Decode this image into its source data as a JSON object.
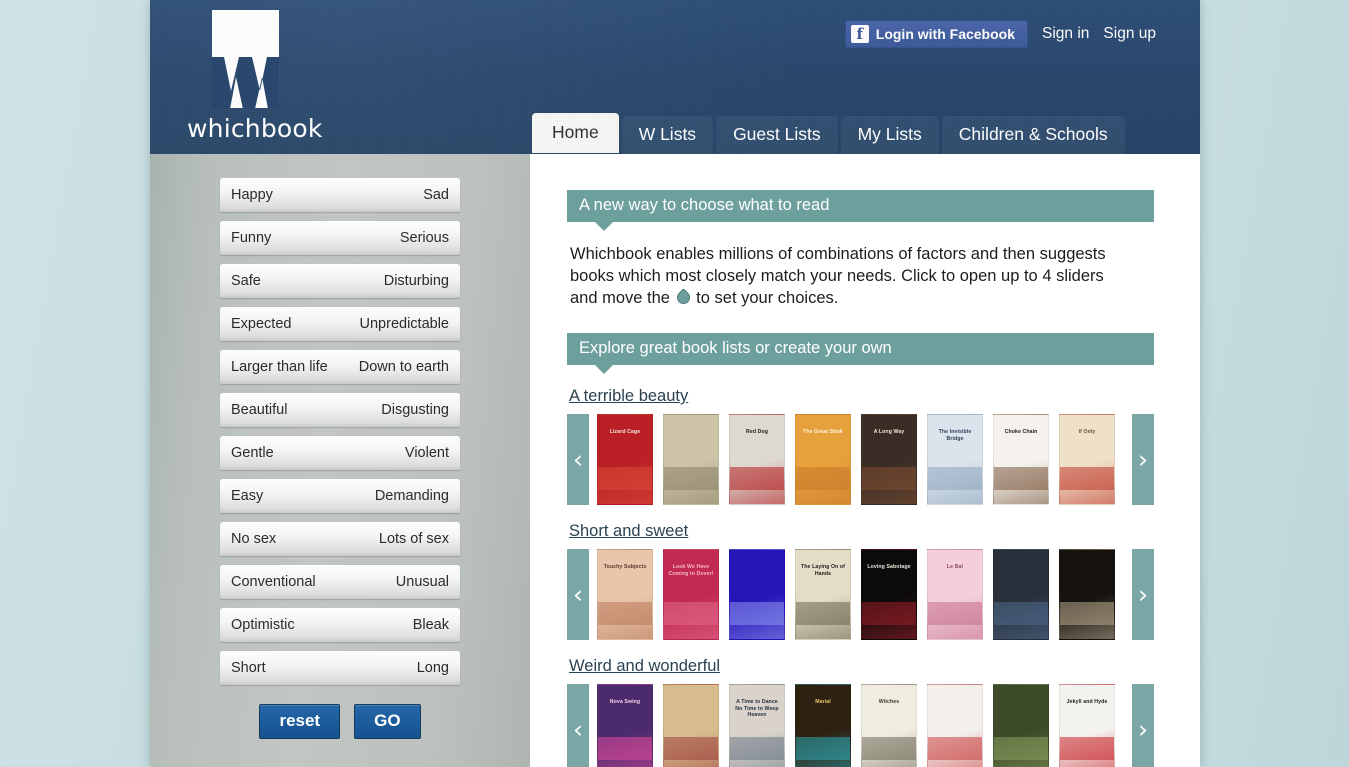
{
  "site": {
    "logo_word": "whichbook",
    "logo_icon": "whichbook-w-logo"
  },
  "header": {
    "facebook_button": "Login with Facebook",
    "facebook_glyph": "f",
    "sign_in": "Sign in",
    "sign_up": "Sign up",
    "nav": [
      {
        "label": "Home",
        "active": true
      },
      {
        "label": "W Lists",
        "active": false
      },
      {
        "label": "Guest Lists",
        "active": false
      },
      {
        "label": "My Lists",
        "active": false
      },
      {
        "label": "Children & Schools",
        "active": false
      }
    ]
  },
  "sidebar": {
    "sliders": [
      {
        "left": "Happy",
        "right": "Sad"
      },
      {
        "left": "Funny",
        "right": "Serious"
      },
      {
        "left": "Safe",
        "right": "Disturbing"
      },
      {
        "left": "Expected",
        "right": "Unpredictable"
      },
      {
        "left": "Larger than life",
        "right": "Down to earth"
      },
      {
        "left": "Beautiful",
        "right": "Disgusting"
      },
      {
        "left": "Gentle",
        "right": "Violent"
      },
      {
        "left": "Easy",
        "right": "Demanding"
      },
      {
        "left": "No sex",
        "right": "Lots of sex"
      },
      {
        "left": "Conventional",
        "right": "Unusual"
      },
      {
        "left": "Optimistic",
        "right": "Bleak"
      },
      {
        "left": "Short",
        "right": "Long"
      }
    ],
    "reset_label": "reset",
    "go_label": "GO"
  },
  "main": {
    "banner_1": "A new way to choose what to read",
    "intro_part_1": "Whichbook enables millions of combinations of factors and then suggests books which most closely match your needs. Click to open up to 4 sliders and move the",
    "intro_part_2": "to set your choices.",
    "banner_2": "Explore great book lists or create your own",
    "prev_arrow": "‹",
    "next_arrow": "›",
    "lists": [
      {
        "title": "A terrible beauty",
        "books": [
          {
            "title": "Lizard Cage",
            "bg": "#bb2027",
            "fg": "#f2e7da",
            "accent": "#d94a36"
          },
          {
            "title": "",
            "bg": "#cdc4a8",
            "fg": "#5c5645",
            "accent": "#8d8468"
          },
          {
            "title": "Red Dog",
            "bg": "#ddd8d0",
            "fg": "#1d1d1d",
            "accent": "#b31f22"
          },
          {
            "title": "The Great Stink",
            "bg": "#e6a13c",
            "fg": "#fdf4e2",
            "accent": "#c8792a"
          },
          {
            "title": "A Long Way",
            "bg": "#3a2d26",
            "fg": "#f0e6d8",
            "accent": "#7d4f32"
          },
          {
            "title": "The Invisible Bridge",
            "bg": "#dbe4ec",
            "fg": "#2c3f56",
            "accent": "#8ea5bd"
          },
          {
            "title": "Choke Chain",
            "bg": "#f5f2ee",
            "fg": "#1c1c1c",
            "accent": "#7b5a3e"
          },
          {
            "title": "If Only",
            "bg": "#efe0c8",
            "fg": "#6a5036",
            "accent": "#c0392b"
          }
        ]
      },
      {
        "title": "Short and sweet",
        "books": [
          {
            "title": "Touchy Subjects",
            "bg": "#e9c6ab",
            "fg": "#53382a",
            "accent": "#b9795a"
          },
          {
            "title": "Look We Have Coming to Dover!",
            "bg": "#c32a52",
            "fg": "#f2b6c6",
            "accent": "#e06a8c"
          },
          {
            "title": "",
            "bg": "#2616b8",
            "fg": "#cfd2f5",
            "accent": "#8d93ee"
          },
          {
            "title": "The Laying On of Hands",
            "bg": "#e3dcc6",
            "fg": "#1d1d1d",
            "accent": "#6c6550"
          },
          {
            "title": "Loving Sabotage",
            "bg": "#0b0b0b",
            "fg": "#e8e2da",
            "accent": "#9c1f28"
          },
          {
            "title": "Le Bal",
            "bg": "#f4cedc",
            "fg": "#8b4a63",
            "accent": "#c4708e"
          },
          {
            "title": "",
            "bg": "#2a2f3c",
            "fg": "#b9c3d4",
            "accent": "#4e6c8d"
          },
          {
            "title": "",
            "bg": "#15120f",
            "fg": "#cfc3b0",
            "accent": "#b9a88d"
          }
        ]
      },
      {
        "title": "Weird and wonderful",
        "books": [
          {
            "title": "Nova Swing",
            "bg": "#4b2b6e",
            "fg": "#f2d0e4",
            "accent": "#e04a9b"
          },
          {
            "title": "",
            "bg": "#d7bd8e",
            "fg": "#5c4424",
            "accent": "#9c3f3a"
          },
          {
            "title": "A Time to Dance No Time to Weep Heaven",
            "bg": "#d9d3cb",
            "fg": "#23303f",
            "accent": "#6b7886"
          },
          {
            "title": "Marial",
            "bg": "#2d2212",
            "fg": "#e8c46a",
            "accent": "#2fa8b5"
          },
          {
            "title": "Witches",
            "bg": "#f1ece0",
            "fg": "#3a3a30",
            "accent": "#6d6a58"
          },
          {
            "title": "",
            "bg": "#f3f0ec",
            "fg": "#46423e",
            "accent": "#c9403f"
          },
          {
            "title": "",
            "bg": "#3d4a2a",
            "fg": "#d9e2c6",
            "accent": "#8aa05e"
          },
          {
            "title": "Jekyll and Hyde",
            "bg": "#f4f2ee",
            "fg": "#1c1c1c",
            "accent": "#c62026"
          }
        ]
      }
    ]
  }
}
